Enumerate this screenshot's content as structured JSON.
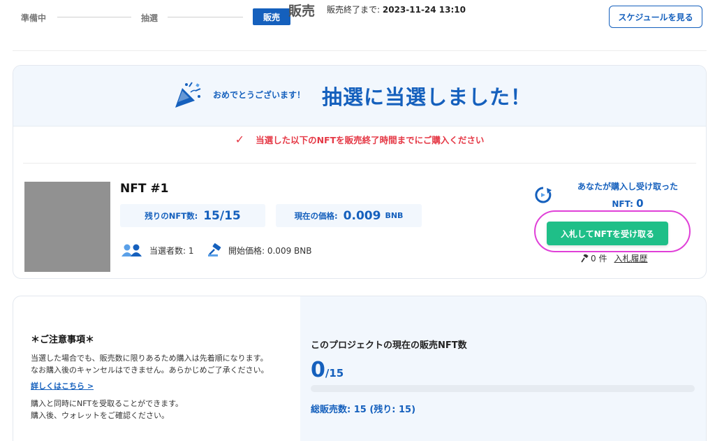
{
  "steps": {
    "step1": "準備中",
    "step2": "抽選",
    "step3": "販売",
    "current_stage": "販売",
    "sale_end_label": "販売終了まで:",
    "sale_end_value": "2023-11-24 13:10",
    "schedule_button": "スケジュールを見る"
  },
  "winner": {
    "congrats_small": "おめでとうございます！",
    "congrats_big": "抽選に当選しました！",
    "notice": "当選した以下のNFTを販売終了時間までにご購入ください"
  },
  "nft": {
    "name": "NFT #1",
    "remaining_label": "残りのNFT数:",
    "remaining_value": "15/15",
    "price_label": "現在の価格:",
    "price_value": "0.009",
    "price_unit": "BNB",
    "winners_label": "当選者数: 1",
    "start_price_label": "開始価格: 0.009 BNB"
  },
  "purchase": {
    "owned_label": "あなたが購入し受け取った",
    "owned_prefix": "NFT:",
    "owned_count": "0",
    "buy_button": "入札してNFTを受け取る",
    "bid_count": "0 件",
    "bid_history": "入札履歴"
  },
  "notes": {
    "title": "＊ご注意事項＊",
    "line1": "当選した場合でも、販売数に限りあるため購入は先着順になります。",
    "line2": "なお購入後のキャンセルはできません。あらかじめご了承ください。",
    "link": "詳しくはこちら >",
    "line3": "購入と同時にNFTを受取ることができます。",
    "line4": "購入後、ウォレットをご確認ください。"
  },
  "sales": {
    "title": "このプロジェクトの現在の販売NFT数",
    "sold": "0",
    "total": "/15",
    "progress_fraction": 0,
    "summary": "総販売数: 15 (残り: 15)"
  },
  "colors": {
    "brand_blue": "#1560bd",
    "buy_green": "#1fbf88",
    "alert_red": "#e53946",
    "highlight_magenta": "#e040d8"
  }
}
